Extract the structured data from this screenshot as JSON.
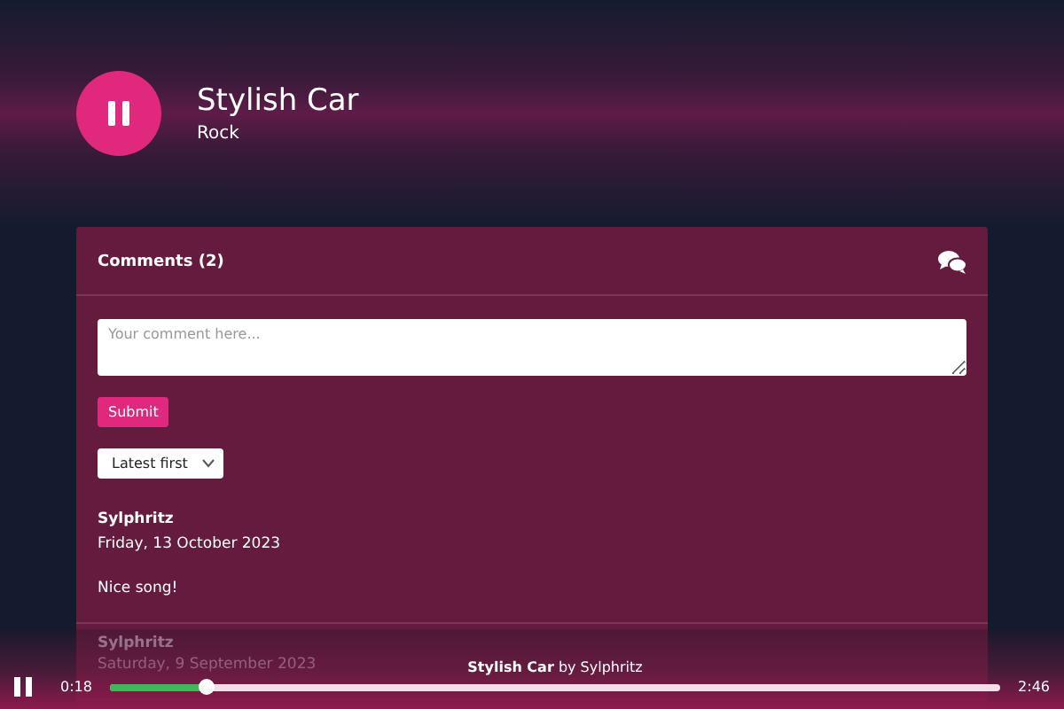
{
  "track": {
    "title": "Stylish Car",
    "genre": "Rock",
    "playing": true
  },
  "comments": {
    "heading": "Comments (2)",
    "placeholder": "Your comment here...",
    "submit": "Submit",
    "sort": "Latest first",
    "items": [
      {
        "author": "Sylphritz",
        "date": "Friday, 13 October 2023",
        "text": "Nice song!"
      },
      {
        "author": "Sylphritz",
        "date": "Saturday, 9 September 2023"
      }
    ]
  },
  "player": {
    "playing": true,
    "elapsed": "0:18",
    "title": "Stylish Car",
    "by": "by Sylphritz",
    "duration": "2:46",
    "level": 0.108
  }
}
